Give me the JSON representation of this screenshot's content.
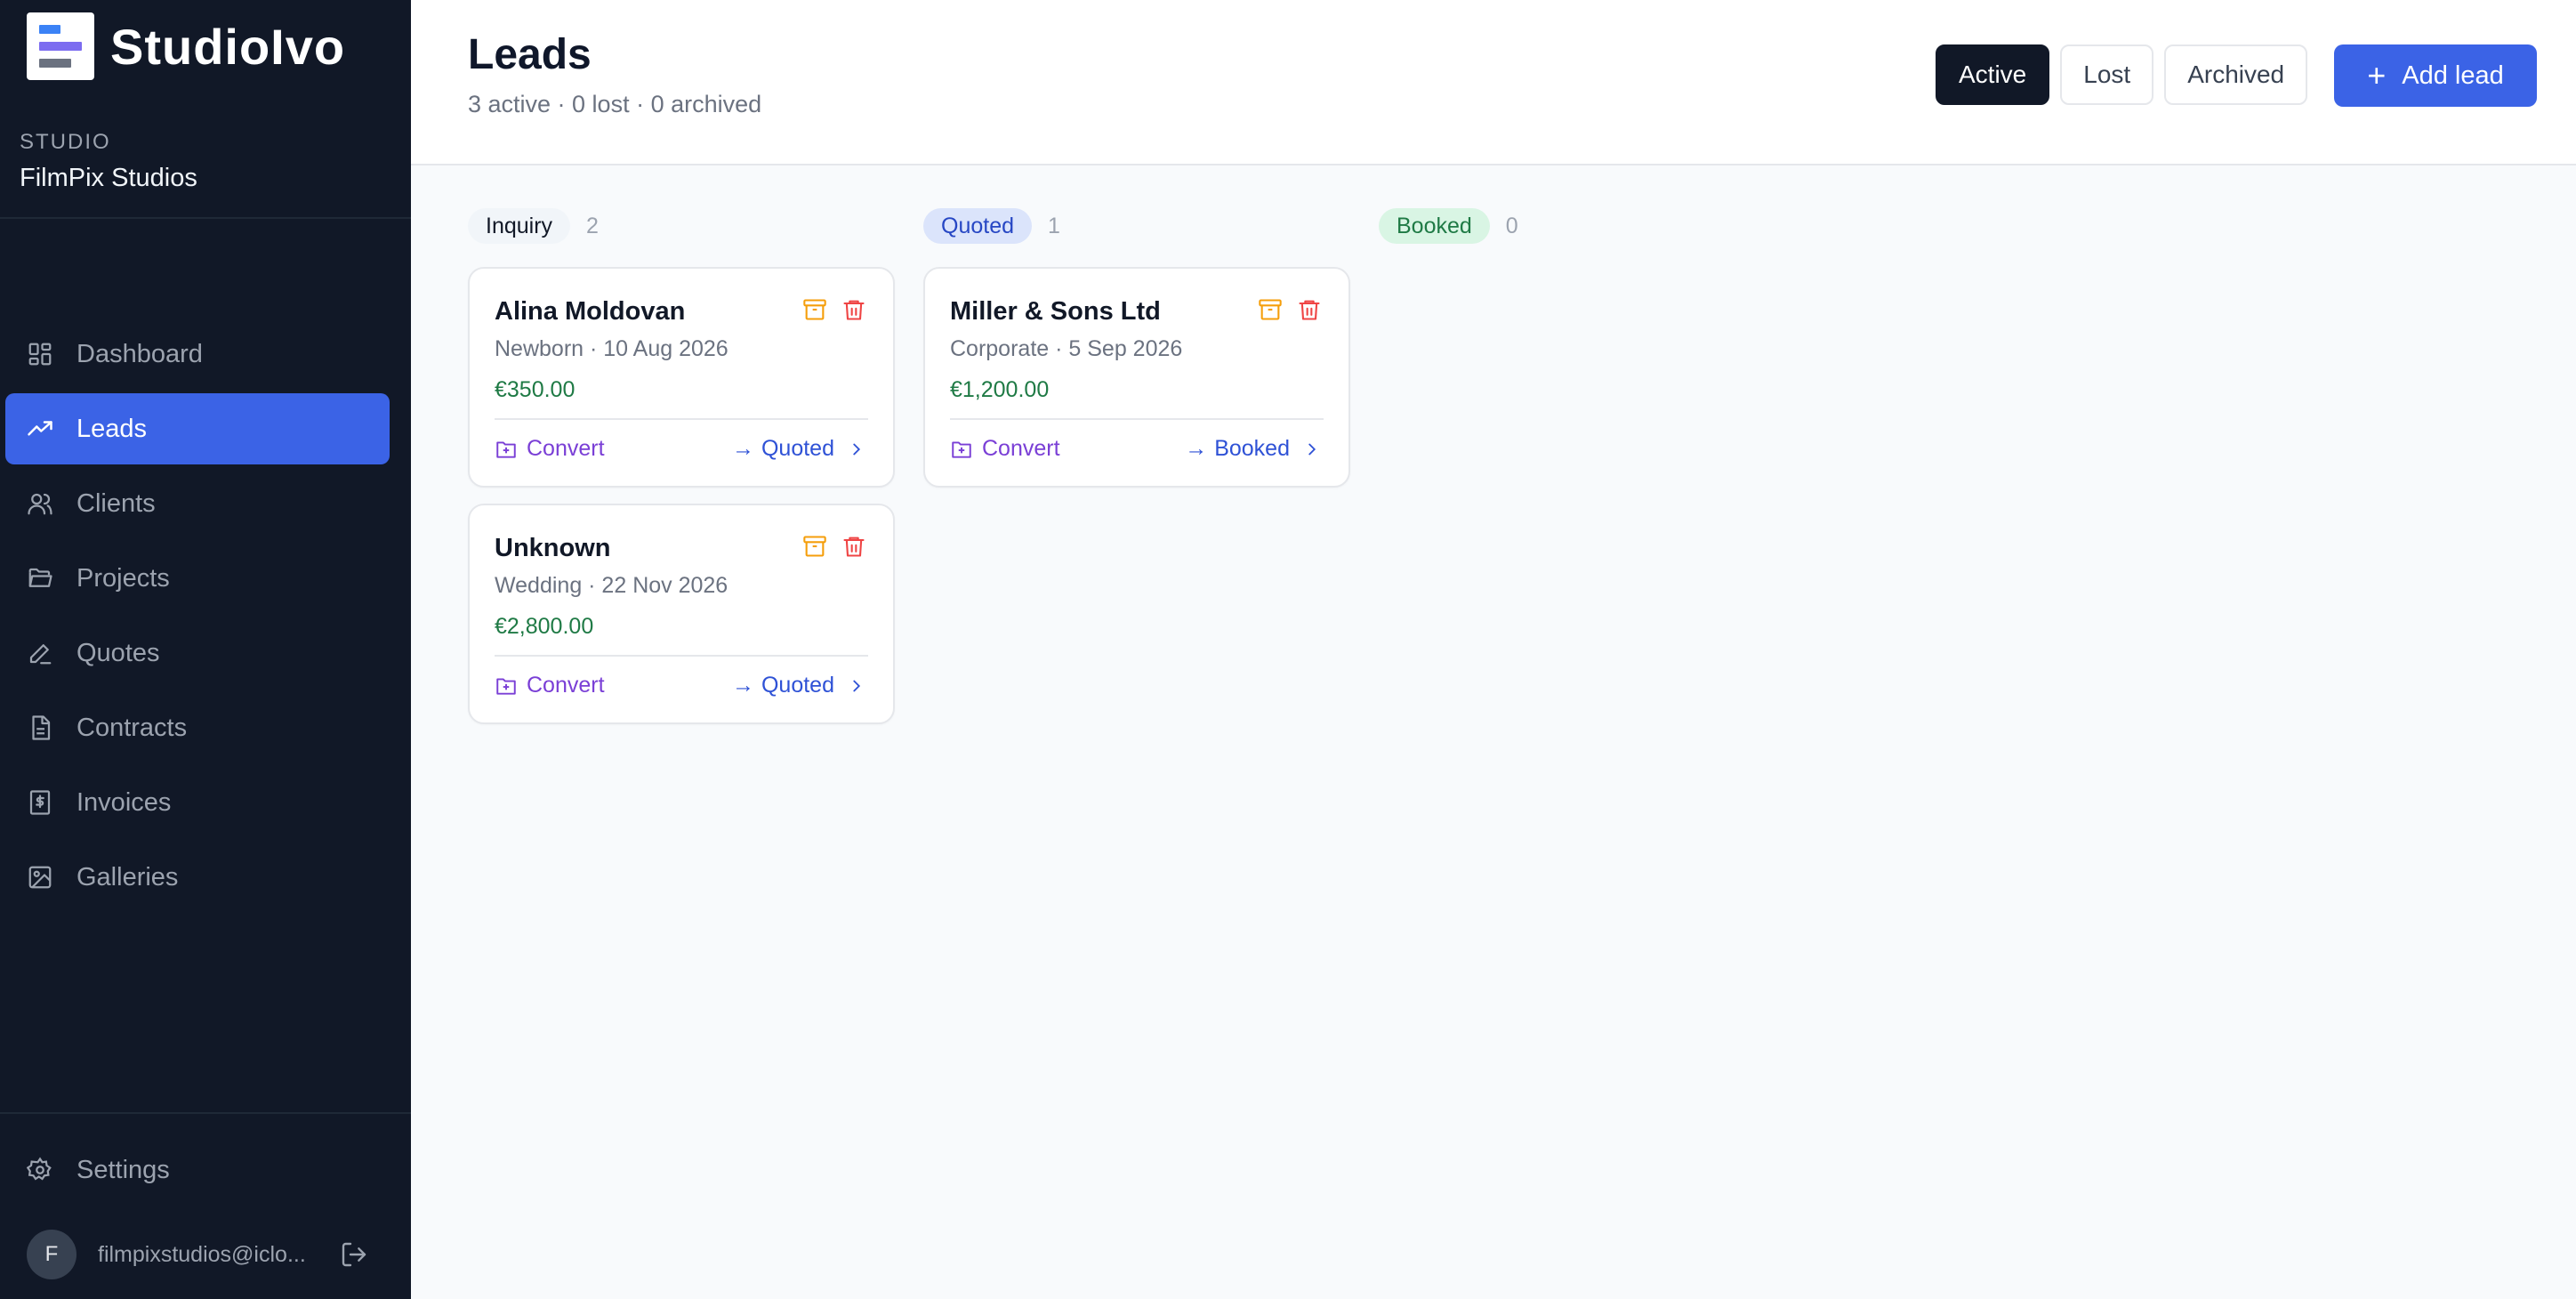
{
  "app": {
    "brand": "StudioIvo"
  },
  "studio": {
    "label": "STUDIO",
    "name": "FilmPix Studios"
  },
  "nav": {
    "items": [
      {
        "label": "Dashboard",
        "icon": "dashboard-icon"
      },
      {
        "label": "Leads",
        "icon": "trending-up-icon",
        "active": true
      },
      {
        "label": "Clients",
        "icon": "users-icon"
      },
      {
        "label": "Projects",
        "icon": "folder-icon"
      },
      {
        "label": "Quotes",
        "icon": "pen-icon"
      },
      {
        "label": "Contracts",
        "icon": "document-icon"
      },
      {
        "label": "Invoices",
        "icon": "receipt-icon"
      },
      {
        "label": "Galleries",
        "icon": "image-icon"
      }
    ],
    "settings": "Settings"
  },
  "user": {
    "initial": "F",
    "email": "filmpixstudios@iclo..."
  },
  "header": {
    "title": "Leads",
    "subtitle": "3 active · 0 lost · 0 archived",
    "filters": [
      "Active",
      "Lost",
      "Archived"
    ],
    "active_filter": "Active",
    "add_label": "Add lead"
  },
  "columns": [
    {
      "stage": "Inquiry",
      "count": "2",
      "cards": [
        {
          "name": "Alina Moldovan",
          "meta": "Newborn · 10 Aug 2026",
          "price": "€350.00",
          "convert": "Convert",
          "next": "Quoted"
        },
        {
          "name": "Unknown",
          "meta": "Wedding · 22 Nov 2026",
          "price": "€2,800.00",
          "convert": "Convert",
          "next": "Quoted"
        }
      ]
    },
    {
      "stage": "Quoted",
      "count": "1",
      "cards": [
        {
          "name": "Miller & Sons Ltd",
          "meta": "Corporate · 5 Sep 2026",
          "price": "€1,200.00",
          "convert": "Convert",
          "next": "Booked"
        }
      ]
    },
    {
      "stage": "Booked",
      "count": "0",
      "cards": []
    }
  ],
  "colors": {
    "sidebar_bg": "#111827",
    "accent": "#3b63e6",
    "price": "#1f7a45",
    "convert": "#7a3fd6",
    "archive": "#f59e0b",
    "delete": "#ef4444"
  }
}
